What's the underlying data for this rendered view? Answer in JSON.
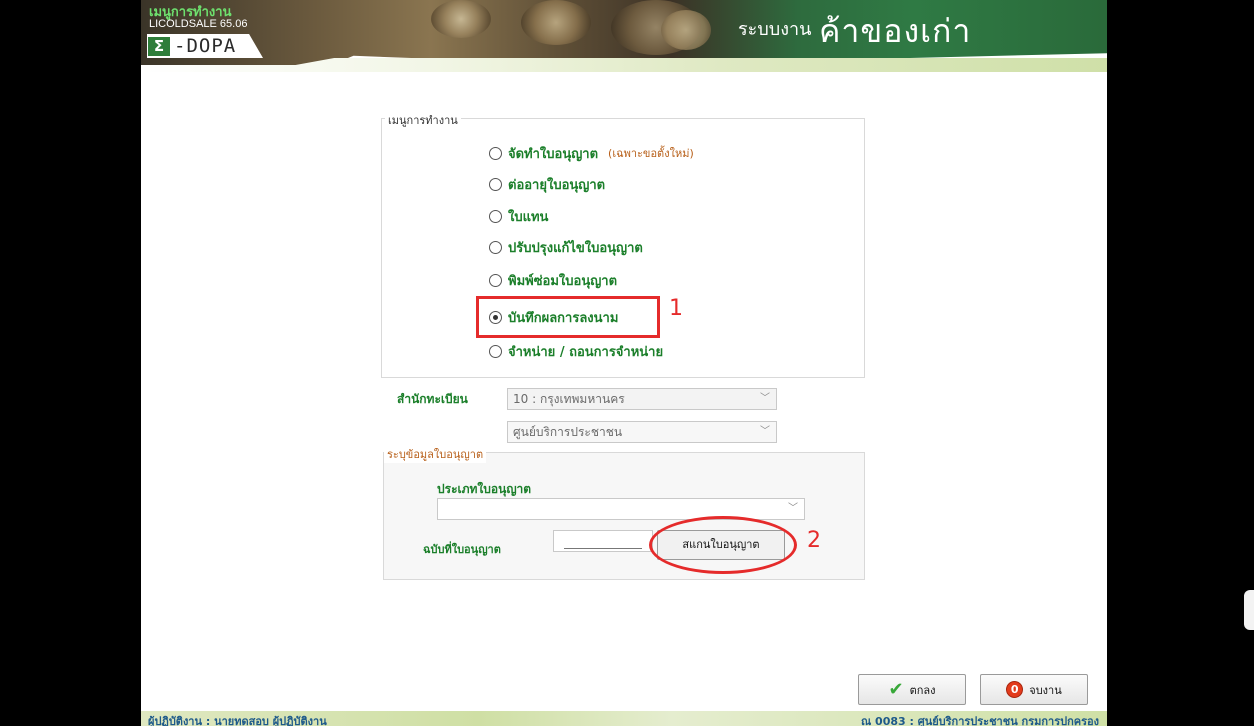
{
  "header": {
    "menu_title": "เมนูการทำงาน",
    "app_code": "LICOLDSALE 65.06",
    "logo_symbol": "Σ",
    "logo_text": "-DOPA",
    "system_label": "ระบบงาน",
    "system_name": "ค้าของเก่า"
  },
  "menu": {
    "legend": "เมนูการทำงาน",
    "options": [
      {
        "label": "จัดทำใบอนุญาต",
        "note": "(เฉพาะขอตั้งใหม่)",
        "checked": false
      },
      {
        "label": "ต่ออายุใบอนุญาต",
        "checked": false
      },
      {
        "label": "ใบแทน",
        "checked": false
      },
      {
        "label": "ปรับปรุงแก้ไขใบอนุญาต",
        "checked": false
      },
      {
        "label": "พิมพ์ซ่อมใบอนุญาต",
        "checked": false
      },
      {
        "label": "บันทึกผลการลงนาม",
        "checked": true
      },
      {
        "label": "จำหน่าย / ถอนการจำหน่าย",
        "checked": false
      }
    ]
  },
  "annotations": {
    "marker_1": "1",
    "marker_2": "2",
    "highlight_color": "#e52b2b"
  },
  "registry": {
    "label": "สำนักทะเบียน",
    "office_value": "10 : กรุงเทพมหานคร",
    "center_value": "ศูนย์บริการประชาชน"
  },
  "license": {
    "legend": "ระบุข้อมูลใบอนุญาต",
    "type_label": "ประเภทใบอนุญาต",
    "type_value": "",
    "number_label": "ฉบับที่ใบอนุญาต",
    "scan_button": "สแกนใบอนุญาต"
  },
  "buttons": {
    "ok": "ตกลง",
    "exit": "จบงาน"
  },
  "footer": {
    "left": "ผู้ปฏิบัติงาน : นายทดสอบ ผู้ปฏิบัติงาน",
    "right": "ณ 0083 : ศูนย์บริการประชาชน กรมการปกครอง"
  },
  "colors": {
    "label_green": "#1b7f2a",
    "note_orange": "#b8601a",
    "footer_blue": "#1e5a8a"
  }
}
